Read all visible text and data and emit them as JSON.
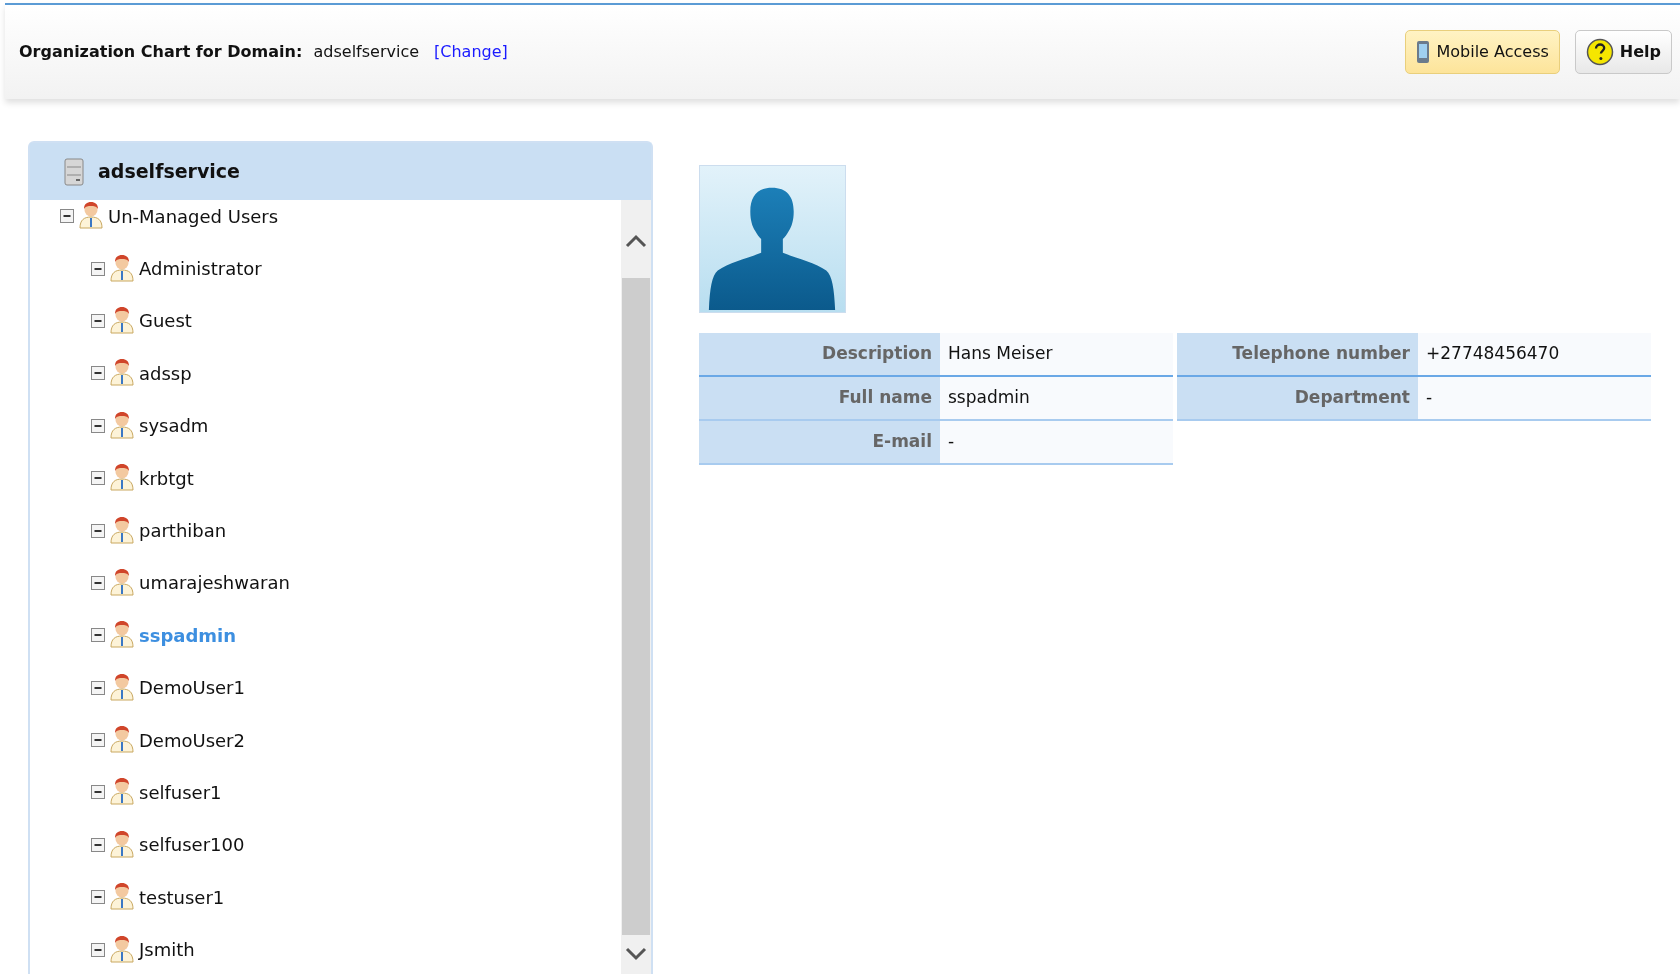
{
  "header": {
    "title": "Organization Chart for Domain:",
    "domain": "adselfservice",
    "change_link": "[Change]",
    "buttons": [
      {
        "kind": "mobile",
        "label": "Mobile Access"
      },
      {
        "kind": "help",
        "label": "Help"
      }
    ]
  },
  "tree": {
    "root": {
      "label": "adselfservice",
      "children": [
        {
          "label": "Un-Managed Users",
          "expanded": true,
          "selected": false,
          "children": [
            {
              "label": "Administrator",
              "expanded": true,
              "selected": false
            },
            {
              "label": "Guest",
              "expanded": true,
              "selected": false
            },
            {
              "label": "adssp",
              "expanded": true,
              "selected": false
            },
            {
              "label": "sysadm",
              "expanded": true,
              "selected": false
            },
            {
              "label": "krbtgt",
              "expanded": true,
              "selected": false
            },
            {
              "label": "parthiban",
              "expanded": true,
              "selected": false
            },
            {
              "label": "umarajeshwaran",
              "expanded": true,
              "selected": false
            },
            {
              "label": "sspadmin",
              "expanded": true,
              "selected": true
            },
            {
              "label": "DemoUser1",
              "expanded": true,
              "selected": false
            },
            {
              "label": "DemoUser2",
              "expanded": true,
              "selected": false
            },
            {
              "label": "selfuser1",
              "expanded": true,
              "selected": false
            },
            {
              "label": "selfuser100",
              "expanded": true,
              "selected": false
            },
            {
              "label": "testuser1",
              "expanded": true,
              "selected": false
            },
            {
              "label": "Jsmith",
              "expanded": true,
              "selected": false
            }
          ]
        }
      ]
    }
  },
  "details": {
    "rows": [
      [
        {
          "label": "Description",
          "value": "Hans Meiser"
        },
        {
          "label": "Telephone number",
          "value": "+27748456470"
        }
      ],
      [
        {
          "label": "Full name",
          "value": "sspadmin"
        },
        {
          "label": "Department",
          "value": "-"
        }
      ],
      [
        {
          "label": "E-mail",
          "value": "-"
        }
      ]
    ]
  }
}
